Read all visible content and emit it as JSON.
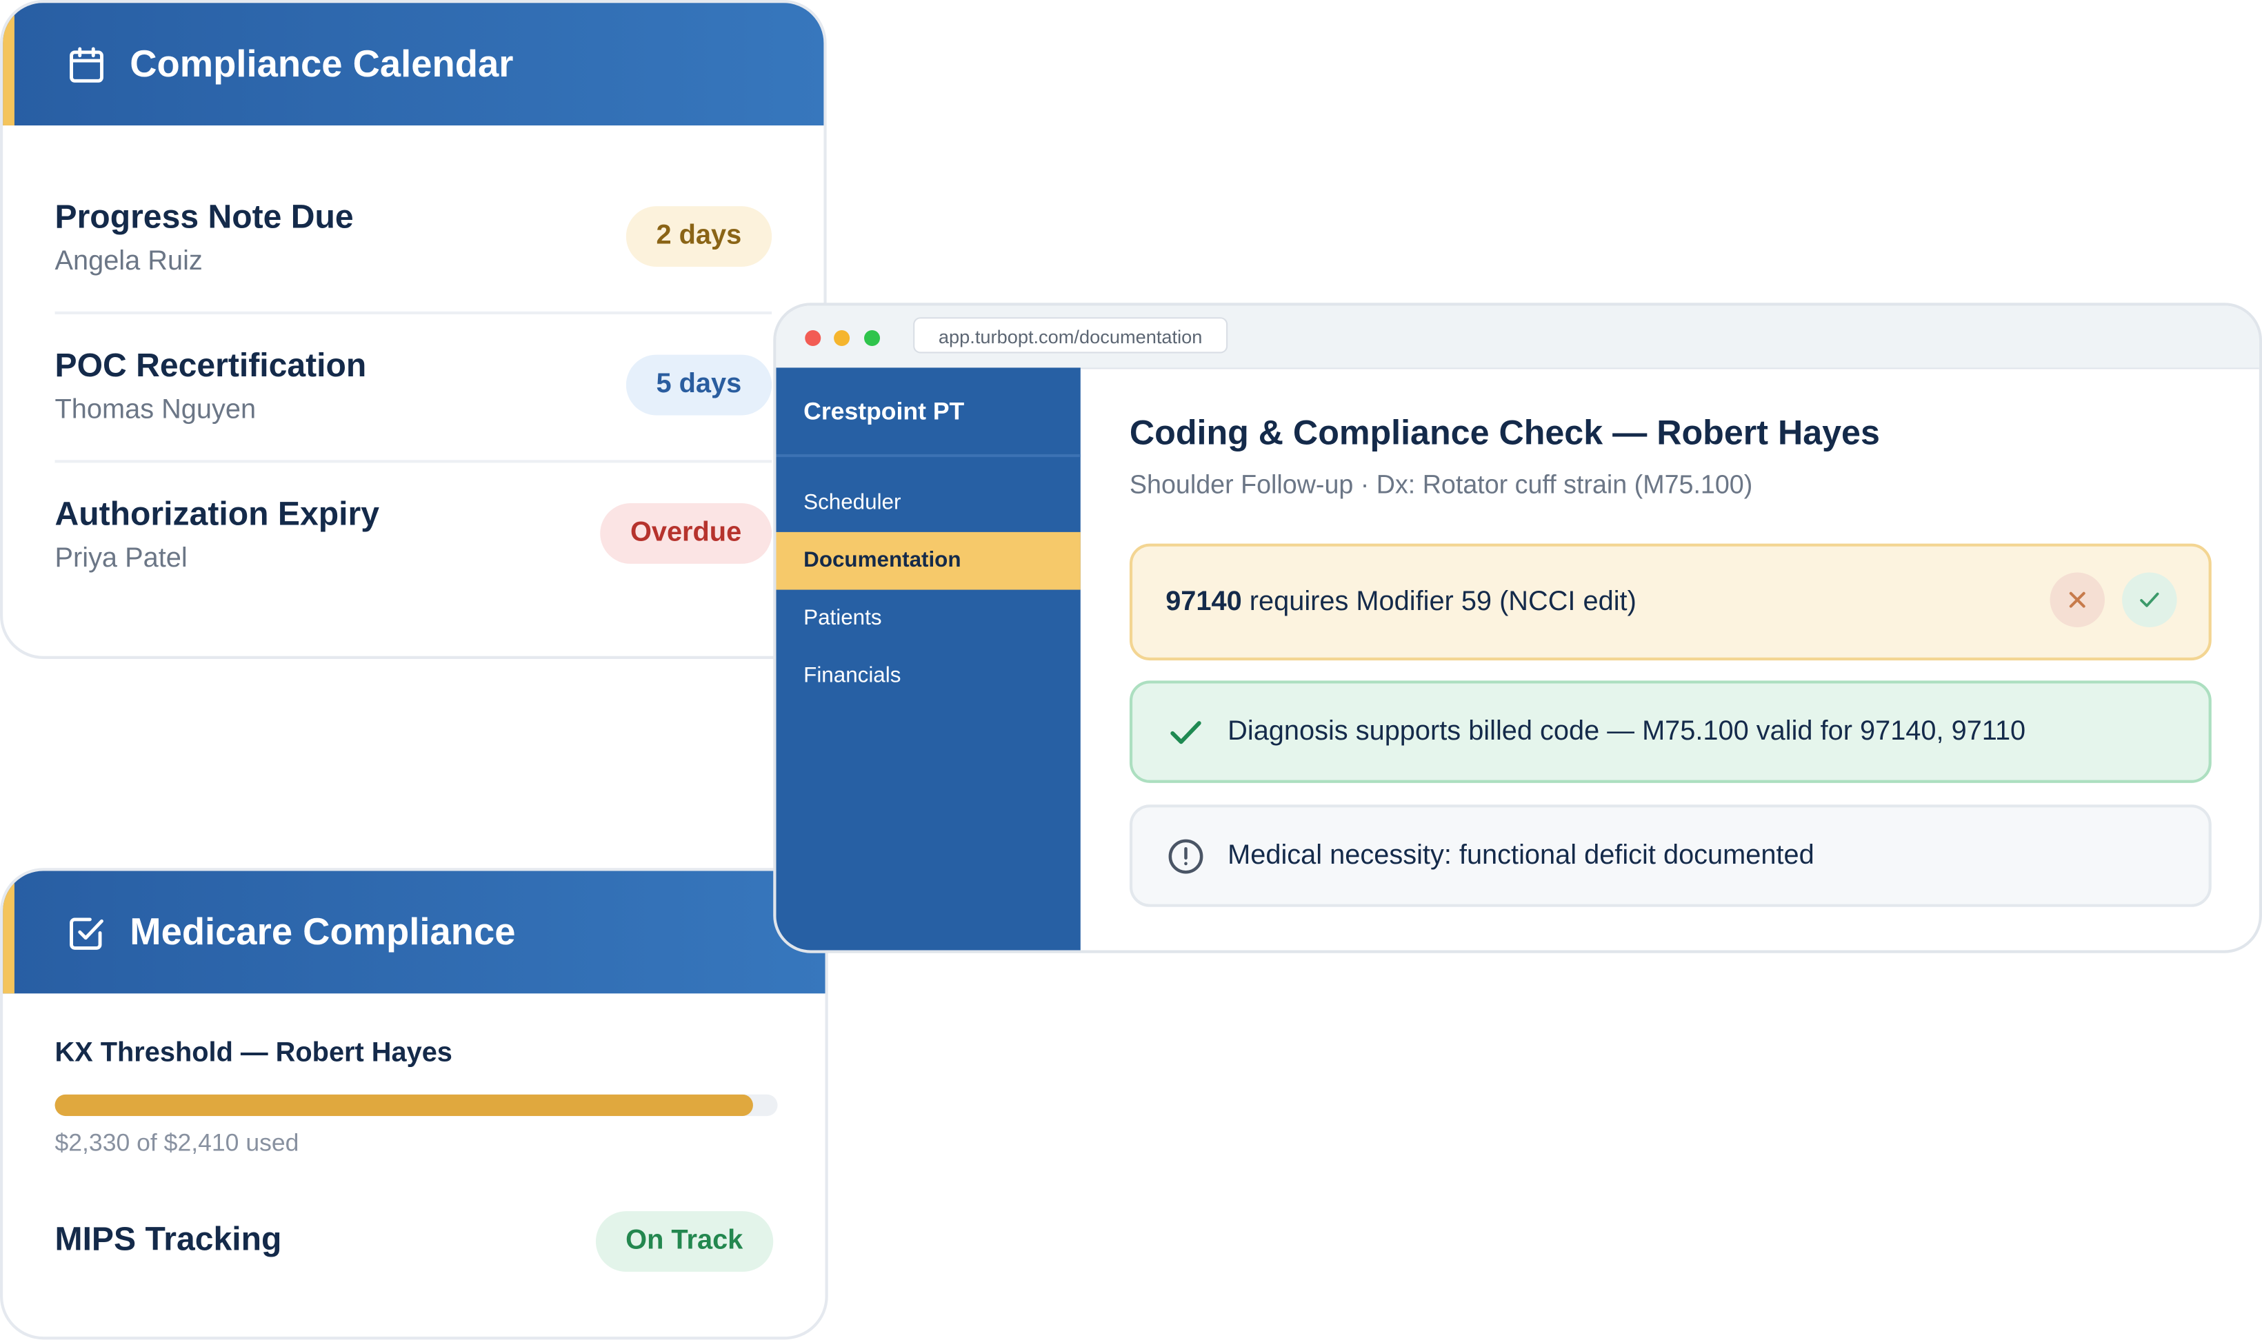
{
  "calendar": {
    "title": "Compliance Calendar",
    "icon": "calendar-icon",
    "items": [
      {
        "title": "Progress Note Due",
        "patient": "Angela Ruiz",
        "badge": "2 days",
        "badge_color": "#fcf2dc"
      },
      {
        "title": "POC Recertification",
        "patient": "Thomas Nguyen",
        "badge": "5 days",
        "badge_color": "#e6f0fb"
      },
      {
        "title": "Authorization Expiry",
        "patient": "Priya Patel",
        "badge": "Overdue",
        "badge_color": "#fbe4e4"
      }
    ]
  },
  "medicare": {
    "title": "Medicare Compliance",
    "icon": "checkbox-icon",
    "kx_label": "KX Threshold — Robert Hayes",
    "kx_usage": "$2,330 of $2,410 used",
    "kx_used_fraction": 0.9668,
    "mips_label": "MIPS Tracking",
    "mips_status": "On Track"
  },
  "browser": {
    "url": "app.turbopt.com/documentation",
    "brand": "Crestpoint PT",
    "nav": [
      {
        "label": "Scheduler",
        "active": false
      },
      {
        "label": "Documentation",
        "active": true
      },
      {
        "label": "Patients",
        "active": false
      },
      {
        "label": "Financials",
        "active": false
      }
    ],
    "page_title": "Coding & Compliance Check — Robert Hayes",
    "page_subtitle": "Shoulder Follow-up · Dx: Rotator cuff strain (M75.100)",
    "alerts": [
      {
        "code": "97140",
        "text": " requires Modifier 59 (NCCI edit)",
        "type": "warning"
      },
      {
        "text": "Diagnosis supports billed code — M75.100 valid for 97140, 97110",
        "type": "success",
        "icon": "check-icon"
      },
      {
        "text": "Medical necessity: functional deficit documented",
        "type": "info",
        "icon": "info-circle-icon"
      }
    ]
  },
  "colors": {
    "header_blue": "#285ea3",
    "sidebar_blue": "#2760a4",
    "accent_yellow": "#f6c96a",
    "progress_amber": "#e0a83e",
    "text_dark": "#142a4a"
  }
}
